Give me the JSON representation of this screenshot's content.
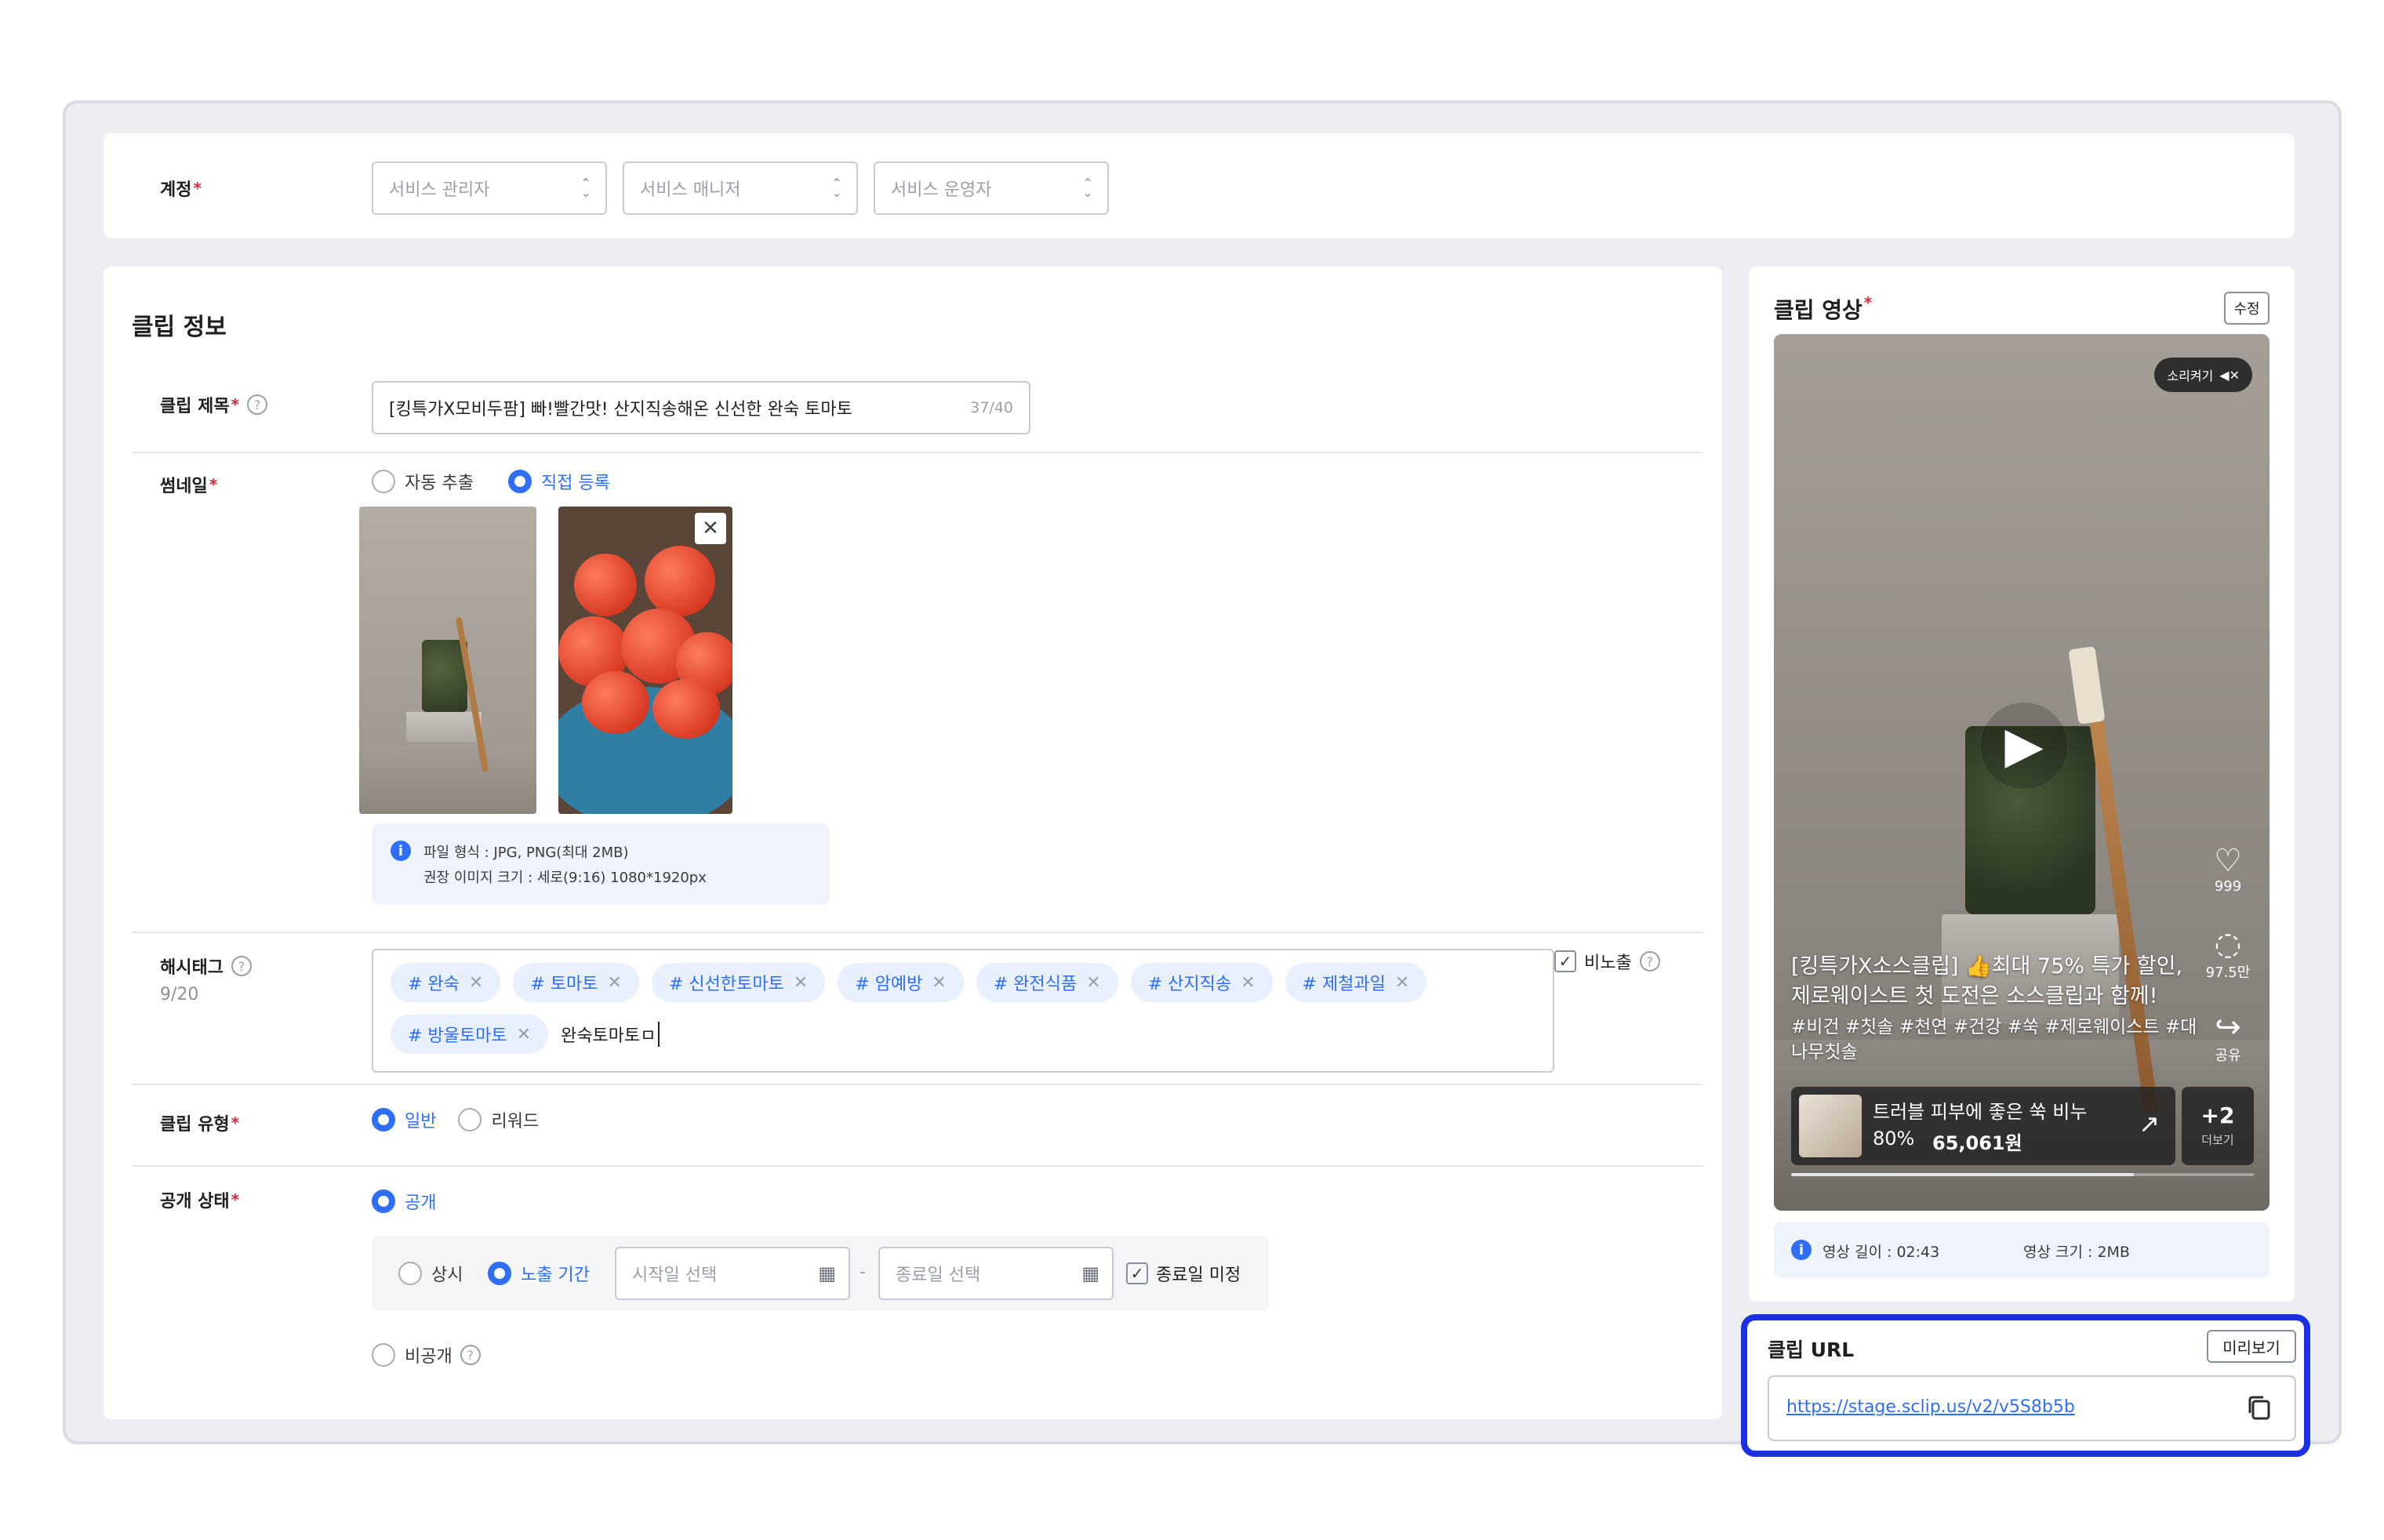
{
  "account": {
    "label": "계정",
    "required": "*",
    "selects": [
      "서비스 관리자",
      "서비스 매니저",
      "서비스 운영자"
    ]
  },
  "clip_info": {
    "heading": "클립 정보",
    "title": {
      "label": "클립 제목",
      "required": "*",
      "value": "[킹특가X모비두팜] 빠!빨간맛! 산지직송해온 신선한 완숙 토마토",
      "counter": "37/40"
    },
    "thumbnail": {
      "label": "썸네일",
      "required": "*",
      "options": [
        "자동 추출",
        "직접 등록"
      ],
      "selected": "직접 등록",
      "info_line1": "파일 형식 : JPG, PNG(최대 2MB)",
      "info_line2": "권장 이미지 크기 : 세로(9:16) 1080*1920px"
    },
    "hashtags": {
      "label": "해시태그",
      "count": "9/20",
      "tags": [
        "# 완숙",
        "# 토마토",
        "# 신선한토마토",
        "# 암예방",
        "# 완전식품",
        "# 산지직송",
        "# 제철과일",
        "# 방울토마토"
      ],
      "typing": "완숙토마토ㅁ",
      "hide_label": "비노출"
    },
    "clip_type": {
      "label": "클립 유형",
      "required": "*",
      "options": [
        "일반",
        "리워드"
      ],
      "selected": "일반"
    },
    "visibility": {
      "label": "공개 상태",
      "required": "*",
      "public": "공개",
      "always": "상시",
      "period": "노출 기간",
      "start_placeholder": "시작일 선택",
      "end_placeholder": "종료일 선택",
      "separator": "-",
      "no_end": "종료일 미정",
      "private": "비공개"
    }
  },
  "clip_video": {
    "heading": "클립 영상",
    "required": "*",
    "edit_button": "수정",
    "mute_label": "소리켜기",
    "likes": "999",
    "comments": "97.5만",
    "share": "공유",
    "caption_line1": "[킹특가X소스클립] 👍최대 75% 특가 할인,",
    "caption_line2": "제로웨이스트 첫 도전은 소스클립과 함께!",
    "caption_tags1": "#비건 #칫솔 #천연 #건강 #쑥 #제로웨이스트 #대",
    "caption_tags2": "나무칫솔",
    "product_name": "트러블 피부에 좋은 쑥 비누",
    "product_discount": "80%",
    "product_price": "65,061원",
    "more_count": "+2",
    "more_label": "더보기",
    "progress": 0.74,
    "duration": "영상 길이 : 02:43",
    "size": "영상 크기 : 2MB"
  },
  "clip_url": {
    "label": "클립 URL",
    "preview_button": "미리보기",
    "url": "https://stage.sclip.us/v2/v5S8b5b"
  },
  "colors": {
    "accent": "#2f6ef6",
    "required": "#e0243a",
    "highlight_border": "#1b2fe6"
  }
}
